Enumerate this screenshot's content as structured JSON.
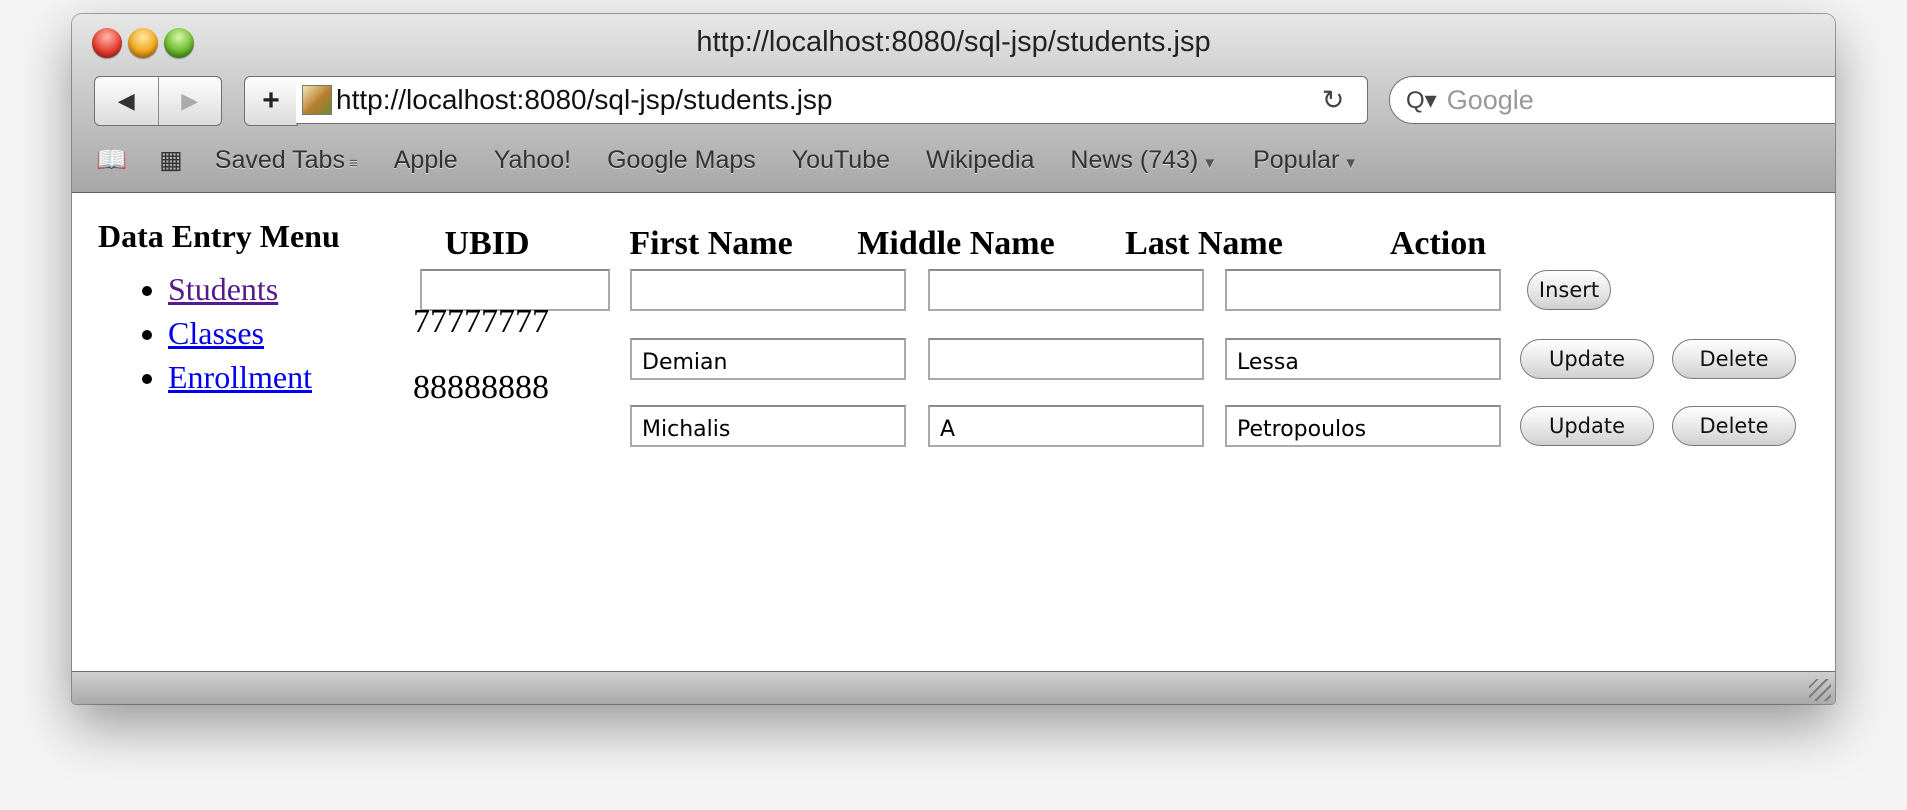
{
  "window": {
    "title": "http://localhost:8080/sql-jsp/students.jsp"
  },
  "toolbar": {
    "back_icon": "◀",
    "forward_icon": "▶",
    "add_icon": "+",
    "url": "http://localhost:8080/sql-jsp/students.jsp",
    "reload_icon": "↻",
    "search_placeholder": "Google",
    "search_icon": "Q▾"
  },
  "bookmarks": {
    "book_icon": "📖",
    "grid_icon": "▦",
    "items": [
      {
        "label": "Saved Tabs",
        "suffix": "≡"
      },
      {
        "label": "Apple",
        "suffix": ""
      },
      {
        "label": "Yahoo!",
        "suffix": ""
      },
      {
        "label": "Google Maps",
        "suffix": ""
      },
      {
        "label": "YouTube",
        "suffix": ""
      },
      {
        "label": "Wikipedia",
        "suffix": ""
      },
      {
        "label": "News (743)",
        "suffix": "▼"
      },
      {
        "label": "Popular",
        "suffix": "▼"
      }
    ]
  },
  "menu": {
    "title": "Data Entry Menu",
    "items": [
      "Students",
      "Classes",
      "Enrollment"
    ]
  },
  "table": {
    "headers": [
      "UBID",
      "First Name",
      "Middle Name",
      "Last Name",
      "Action"
    ],
    "insert_label": "Insert",
    "update_label": "Update",
    "delete_label": "Delete",
    "rows": [
      {
        "ubid": "77777777",
        "first": "Demian",
        "middle": "",
        "last": "Lessa"
      },
      {
        "ubid": "88888888",
        "first": "Michalis",
        "middle": "A",
        "last": "Petropoulos"
      }
    ]
  }
}
